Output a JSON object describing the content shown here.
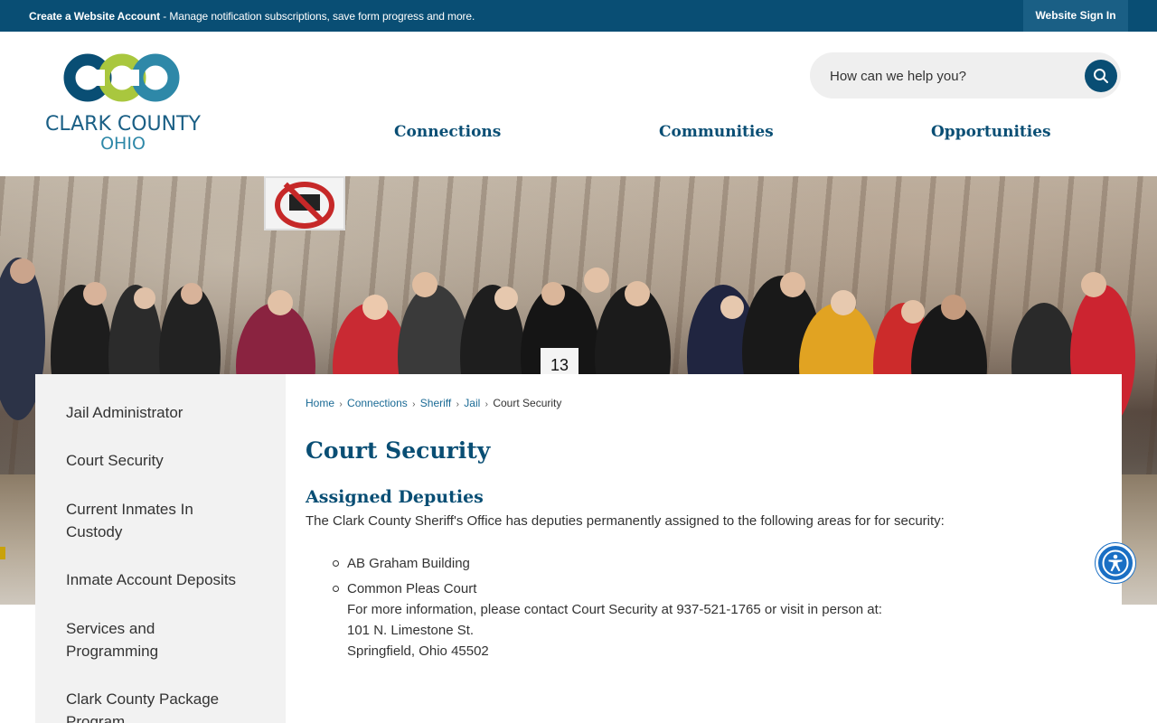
{
  "topbar": {
    "create_account_bold": "Create a Website Account",
    "create_account_rest": " - Manage notification subscriptions, save form progress and more.",
    "signin_label": "Website Sign In"
  },
  "logo": {
    "name": "CLARK COUNTY",
    "sub": "OHIO",
    "colors": {
      "dark_blue": "#094e74",
      "green": "#a9c73e",
      "teal": "#2e88a8"
    }
  },
  "search": {
    "placeholder": "How can we help you?",
    "icon": "search-icon"
  },
  "nav": {
    "items": [
      {
        "label": "Connections"
      },
      {
        "label": "Communities"
      },
      {
        "label": "Opportunities"
      }
    ]
  },
  "hero": {
    "bib_number": "13"
  },
  "sidebar": {
    "items": [
      {
        "label": "Jail Administrator"
      },
      {
        "label": "Court Security"
      },
      {
        "label": "Current Inmates In Custody"
      },
      {
        "label": "Inmate Account Deposits"
      },
      {
        "label": "Services and Programming"
      },
      {
        "label": "Clark County Package Program"
      }
    ]
  },
  "breadcrumb": {
    "items": [
      {
        "label": "Home"
      },
      {
        "label": "Connections"
      },
      {
        "label": "Sheriff"
      },
      {
        "label": "Jail"
      }
    ],
    "current": "Court Security",
    "separator": "›"
  },
  "content": {
    "title": "Court Security",
    "section_title": "Assigned Deputies",
    "intro": "The Clark County Sheriff's Office has deputies permanently assigned to the following areas for for security:",
    "list": [
      {
        "text": "AB Graham Building"
      },
      {
        "text": "Common Pleas Court",
        "lines": [
          "For more information, please contact Court Security at 937-521-1765 or visit in person at:",
          "101 N. Limestone St.",
          "Springfield, Ohio 45502"
        ]
      }
    ]
  },
  "accessibility": {
    "icon": "accessibility-icon"
  },
  "colors": {
    "brand_dark": "#094e74",
    "topbar": "#094e74",
    "link": "#1a6a95",
    "sidebar_bg": "#f2f2f2"
  }
}
